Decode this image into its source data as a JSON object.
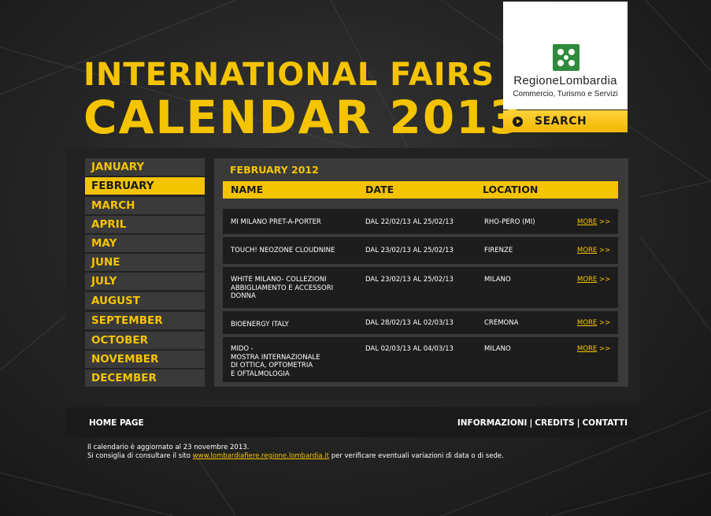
{
  "header": {
    "title_line1": "INTERNATIONAL FAIRS",
    "title_line2": "CALENDAR 2013"
  },
  "logo": {
    "name": "RegioneLombardia",
    "subtitle": "Commercio, Turismo e Servizi",
    "icon": "lombardia-rose-icon"
  },
  "search": {
    "label": "SEARCH",
    "icon": "play-icon"
  },
  "months": [
    "JANUARY",
    "FEBRUARY",
    "MARCH",
    "APRIL",
    "MAY",
    "JUNE",
    "JULY",
    "AUGUST",
    "SEPTEMBER",
    "OCTOBER",
    "NOVEMBER",
    "DECEMBER"
  ],
  "active_month": "FEBRUARY",
  "content": {
    "title": "FEBRUARY 2012",
    "columns": {
      "name": "NAME",
      "date": "DATE",
      "location": "LOCATION"
    },
    "more_label": "MORE",
    "more_arrow": ">>",
    "rows": [
      {
        "name": "MI MILANO PRET-A-PORTER",
        "date": "DAL 22/02/13 AL 25/02/13",
        "location": "RHO-PERO (MI)"
      },
      {
        "name": "TOUCH! NEOZONE CLOUDNINE",
        "date": "DAL 23/02/13 AL 25/02/13",
        "location": "FIRENZE"
      },
      {
        "name": "WHITE MILANO- COLLEZIONI\nABBIGLIAMENTO E ACCESSORI\nDONNA",
        "date": "DAL 23/02/13 AL 25/02/13",
        "location": "MILANO"
      },
      {
        "name": "BIOENERGY ITALY",
        "date": "DAL 28/02/13 AL 02/03/13",
        "location": "CREMONA"
      },
      {
        "name": "MIDO -\nMOSTRA INTERNAZIONALE\nDI OTTICA, OPTOMETRIA\nE OFTALMOLOGIA",
        "date": "DAL 02/03/13 AL 04/03/13",
        "location": "MILANO"
      }
    ]
  },
  "footer": {
    "home": "HOME PAGE",
    "links": [
      "INFORMAZIONI",
      "CREDITS",
      "CONTATTI"
    ],
    "separator": "|",
    "note_line1": "Il calendario è aggiornato al 23 novembre 2013.",
    "note_line2_prefix": "Si consiglia di consultare il sito ",
    "note_link": "www.lombardiafiere.regione.lombardia.it",
    "note_line2_suffix": " per verificare eventuali variazioni di data o di sede."
  },
  "colors": {
    "accent": "#f5c400",
    "background": "#262626",
    "panel": "#3a3a3a"
  }
}
